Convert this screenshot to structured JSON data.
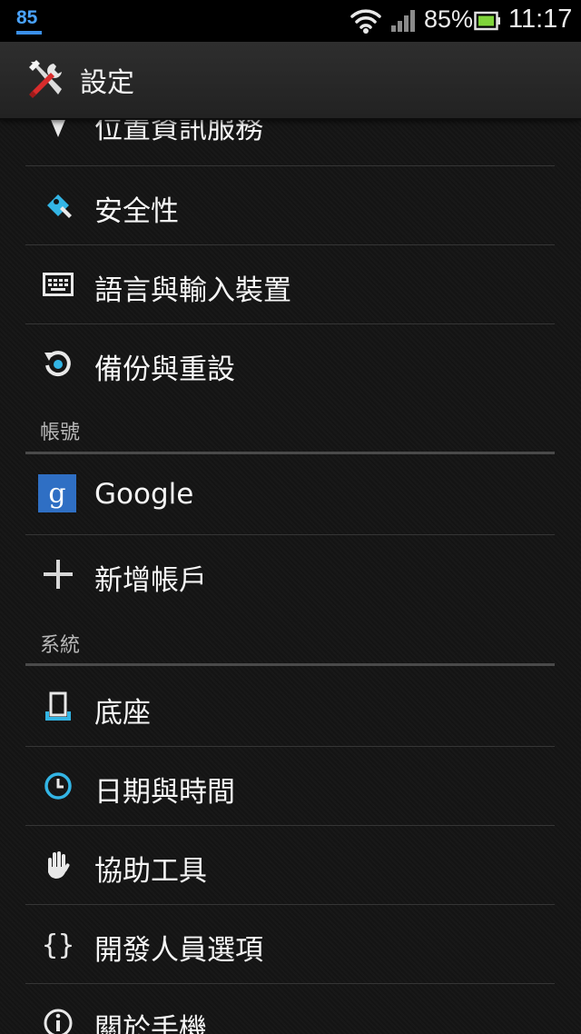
{
  "status_bar": {
    "notification": "85",
    "battery_percent": "85%",
    "time": "11:17",
    "icons": [
      "wifi-icon",
      "signal-icon",
      "battery-icon"
    ]
  },
  "action_bar": {
    "title": "設定",
    "icon": "settings-tools-icon"
  },
  "items": {
    "location": {
      "label": "位置資訊服務",
      "icon": "location-icon"
    },
    "security": {
      "label": "安全性",
      "icon": "key-icon"
    },
    "language": {
      "label": "語言與輸入裝置",
      "icon": "keyboard-icon"
    },
    "backup": {
      "label": "備份與重設",
      "icon": "backup-restore-icon"
    },
    "google": {
      "label": "Google",
      "icon": "google-icon"
    },
    "add_account": {
      "label": "新增帳戶",
      "icon": "plus-icon"
    },
    "dock": {
      "label": "底座",
      "icon": "dock-icon"
    },
    "datetime": {
      "label": "日期與時間",
      "icon": "clock-icon"
    },
    "accessibility": {
      "label": "協助工具",
      "icon": "hand-icon"
    },
    "developer": {
      "label": "開發人員選項",
      "icon": "braces-icon"
    },
    "about": {
      "label": "關於手機",
      "icon": "info-icon"
    }
  },
  "sections": {
    "accounts": "帳號",
    "system": "系統"
  },
  "colors": {
    "accent_blue": "#33b5e5",
    "google_blue": "#2f6fc4",
    "background": "#141414"
  }
}
